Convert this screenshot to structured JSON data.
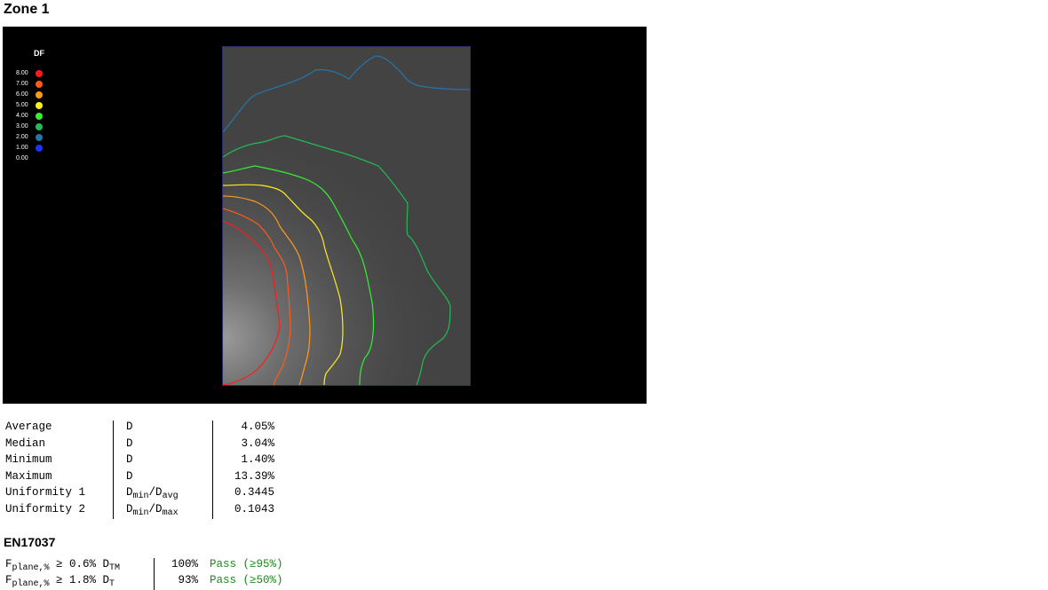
{
  "zone_title": "Zone 1",
  "legend": {
    "title": "DF",
    "items": [
      {
        "label": "8.00",
        "color": "#ff1a1a"
      },
      {
        "label": "7.00",
        "color": "#ff5a1a"
      },
      {
        "label": "6.00",
        "color": "#ff9a1a"
      },
      {
        "label": "5.00",
        "color": "#ffee1a"
      },
      {
        "label": "4.00",
        "color": "#33ee33"
      },
      {
        "label": "3.00",
        "color": "#22bb55"
      },
      {
        "label": "2.00",
        "color": "#2277aa"
      },
      {
        "label": "1.00",
        "color": "#1a33ff"
      },
      {
        "label": "0.00",
        "color": ""
      }
    ]
  },
  "stats": [
    {
      "label": "Average",
      "sym": "D",
      "sub1": "",
      "mid": "",
      "sym2": "",
      "sub2": "",
      "value": "4.05%"
    },
    {
      "label": "Median",
      "sym": "D",
      "sub1": "",
      "mid": "",
      "sym2": "",
      "sub2": "",
      "value": "3.04%"
    },
    {
      "label": "Minimum",
      "sym": "D",
      "sub1": "",
      "mid": "",
      "sym2": "",
      "sub2": "",
      "value": "1.40%"
    },
    {
      "label": "Maximum",
      "sym": "D",
      "sub1": "",
      "mid": "",
      "sym2": "",
      "sub2": "",
      "value": "13.39%"
    },
    {
      "label": "Uniformity 1",
      "sym": "D",
      "sub1": "min",
      "mid": "/",
      "sym2": "D",
      "sub2": "avg",
      "value": "0.3445"
    },
    {
      "label": "Uniformity 2",
      "sym": "D",
      "sub1": "min",
      "mid": "/",
      "sym2": "D",
      "sub2": "max",
      "value": "0.1043"
    }
  ],
  "en_title": "EN17037",
  "en_rows": [
    {
      "f": "F",
      "fsub": "plane,%",
      "cond": " ≥ 0.6% D",
      "csub": "TM",
      "value": "100%",
      "result": "Pass (≥95%)"
    },
    {
      "f": "F",
      "fsub": "plane,%",
      "cond": " ≥ 1.8% D",
      "csub": "T",
      "value": "93%",
      "result": "Pass (≥50%)"
    }
  ]
}
